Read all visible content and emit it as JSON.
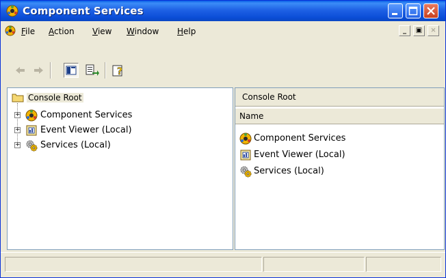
{
  "window": {
    "title": "Component Services"
  },
  "menu": {
    "items": [
      {
        "accel": "F",
        "rest": "ile"
      },
      {
        "accel": "A",
        "rest": "ction"
      },
      {
        "accel": "V",
        "rest": "iew"
      },
      {
        "accel": "W",
        "rest": "indow"
      },
      {
        "accel": "H",
        "rest": "elp"
      }
    ],
    "mdi_min": "_",
    "mdi_restore": "▣",
    "mdi_close": "×"
  },
  "toolbar": {
    "back_icon": "back-arrow-icon",
    "forward_icon": "forward-arrow-icon",
    "show_hide_tree_icon": "show-hide-console-tree-icon",
    "export_list_icon": "export-list-icon",
    "help_icon": "help-icon"
  },
  "tree": {
    "root_label": "Console Root",
    "expander": "+",
    "items": [
      {
        "label": "Component Services",
        "icon": "component-services-icon"
      },
      {
        "label": "Event Viewer (Local)",
        "icon": "event-viewer-icon"
      },
      {
        "label": "Services (Local)",
        "icon": "services-gears-icon"
      }
    ]
  },
  "details": {
    "header": "Console Root",
    "column_name": "Name",
    "items": [
      {
        "label": "Component Services",
        "icon": "component-services-icon"
      },
      {
        "label": "Event Viewer (Local)",
        "icon": "event-viewer-icon"
      },
      {
        "label": "Services (Local)",
        "icon": "services-gears-icon"
      }
    ]
  },
  "colors": {
    "titlebar": "#0a5fe6",
    "chrome": "#ece9d8",
    "pane_border": "#7f9db9"
  }
}
